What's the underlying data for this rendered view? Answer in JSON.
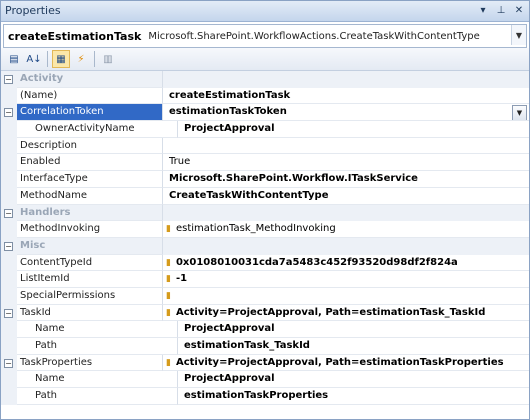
{
  "window": {
    "title": "Properties",
    "pin_icon": "pin-icon",
    "close_icon": "close-icon"
  },
  "object": {
    "name": "createEstimationTask",
    "type": "Microsoft.SharePoint.WorkflowActions.CreateTaskWithContentType"
  },
  "toolbar": {
    "buttons": [
      "categorized-icon",
      "alphabetical-icon",
      "properties-icon",
      "events-icon",
      "property-pages-icon"
    ]
  },
  "grid": {
    "categories": {
      "activity": "Activity",
      "handlers": "Handlers",
      "misc": "Misc"
    },
    "rows": {
      "name": {
        "label": "(Name)",
        "value": "createEstimationTask"
      },
      "correlation": {
        "label": "CorrelationToken",
        "value": "estimationTaskToken"
      },
      "owner": {
        "label": "OwnerActivityName",
        "value": "ProjectApproval"
      },
      "description": {
        "label": "Description",
        "value": ""
      },
      "enabled": {
        "label": "Enabled",
        "value": "True"
      },
      "interface": {
        "label": "InterfaceType",
        "value": "Microsoft.SharePoint.Workflow.ITaskService"
      },
      "method": {
        "label": "MethodName",
        "value": "CreateTaskWithContentType"
      },
      "invoking": {
        "label": "MethodInvoking",
        "value": "estimationTask_MethodInvoking"
      },
      "contenttype": {
        "label": "ContentTypeId",
        "value": "0x0108010031cda7a5483c452f93520d98df2f824a"
      },
      "listitem": {
        "label": "ListItemId",
        "value": "-1"
      },
      "special": {
        "label": "SpecialPermissions",
        "value": ""
      },
      "taskid": {
        "label": "TaskId",
        "value": "Activity=ProjectApproval, Path=estimationTask_TaskId"
      },
      "taskid_name": {
        "label": "Name",
        "value": "ProjectApproval"
      },
      "taskid_path": {
        "label": "Path",
        "value": "estimationTask_TaskId"
      },
      "taskprops": {
        "label": "TaskProperties",
        "value": "Activity=ProjectApproval, Path=estimationTaskProperties"
      },
      "taskprops_name": {
        "label": "Name",
        "value": "ProjectApproval"
      },
      "taskprops_path": {
        "label": "Path",
        "value": "estimationTaskProperties"
      }
    }
  },
  "colors": {
    "selection": "#3169c6",
    "bind_icon": "#d59b1c",
    "category_bg": "#edf1f7"
  }
}
